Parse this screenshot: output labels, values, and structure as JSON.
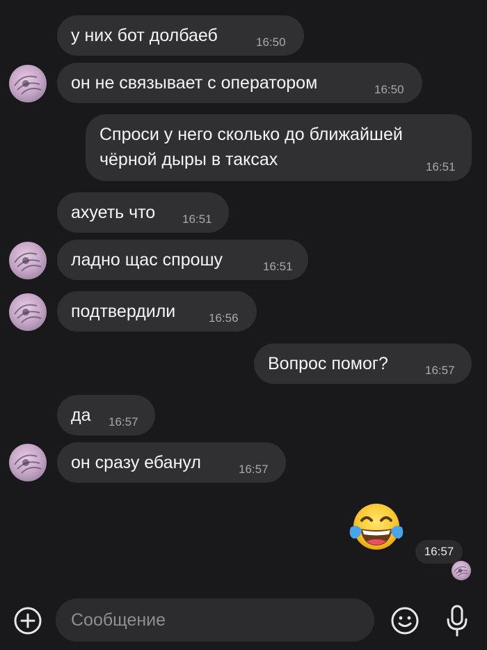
{
  "messages": [
    {
      "text": "у них бот долбаеб",
      "time": "16:50",
      "side": "in"
    },
    {
      "text": "он не связывает с оператором",
      "time": "16:50",
      "side": "in"
    },
    {
      "text": "Спроси у него сколько до ближайшей чёрной дыры в таксах",
      "line1": "Спроси у него сколько до ближайшей",
      "line2": "чёрной дыры в таксах",
      "time": "16:51",
      "side": "out"
    },
    {
      "text": "ахуеть что",
      "time": "16:51",
      "side": "in"
    },
    {
      "text": "ладно щас спрошу",
      "time": "16:51",
      "side": "in"
    },
    {
      "text": "подтвердили",
      "time": "16:56",
      "side": "in"
    },
    {
      "text": "Вопрос помог?",
      "time": "16:57",
      "side": "out"
    },
    {
      "text": "да",
      "time": "16:57",
      "side": "in"
    },
    {
      "text": "он сразу ебанул",
      "time": "16:57",
      "side": "in"
    },
    {
      "emoji": "face-with-tears-of-joy",
      "time": "16:57",
      "side": "out"
    }
  ],
  "composer": {
    "placeholder": "Сообщение",
    "attach_icon": "plus-circle-icon",
    "emoji_icon": "smile-icon",
    "voice_icon": "microphone-icon"
  },
  "colors": {
    "background": "#19191b",
    "bubble": "#303032",
    "timestamp": "#a8a8aa"
  }
}
